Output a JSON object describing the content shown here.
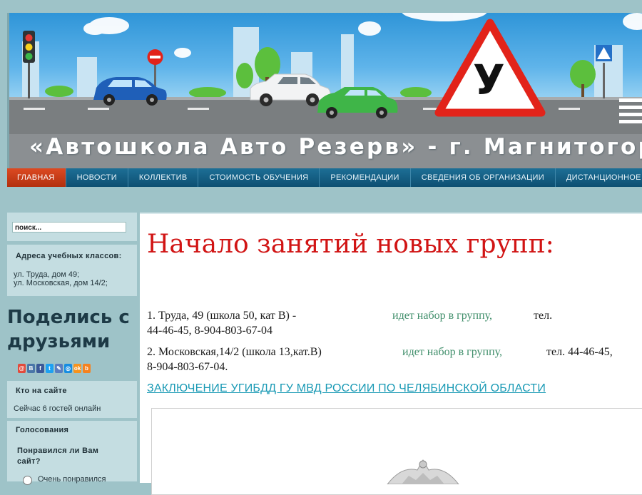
{
  "banner": {
    "title": "«Автошкола Авто Резерв» - г. Магнитогорск",
    "sign_letter": "У"
  },
  "nav": {
    "items": [
      {
        "label": "ГЛАВНАЯ",
        "active": true
      },
      {
        "label": "НОВОСТИ"
      },
      {
        "label": "КОЛЛЕКТИВ"
      },
      {
        "label": "СТОИМОСТЬ ОБУЧЕНИЯ"
      },
      {
        "label": "РЕКОМЕНДАЦИИ"
      },
      {
        "label": "СВЕДЕНИЯ ОБ ОРГАНИЗАЦИИ"
      },
      {
        "label": "ДИСТАНЦИОННОЕ ОБУЧЕНИЕ"
      }
    ]
  },
  "sidebar": {
    "search_placeholder": "поиск...",
    "addresses_heading": "Адреса учебных классов:",
    "address_1": "ул. Труда, дом 49;",
    "address_2": "ул. Московская, дом 14/2;",
    "share_title_1": "Поделись с",
    "share_title_2": "друзьями",
    "who_heading": "Кто на сайте",
    "who_text": "Сейчас 6 гостей онлайн",
    "poll_heading": "Голосования",
    "poll_question_1": "Понравился ли Вам",
    "poll_question_2": "сайт?",
    "poll_option_1": "Очень понравился"
  },
  "main": {
    "title": "Начало занятий новых групп:",
    "line1_a": "1. Труда, 49 (школа 50, кат В) -",
    "line1_b": "идет набор в группу,",
    "line1_c": "тел.",
    "line1_d": "44-46-45, 8-904-803-67-04",
    "line2_a": "2. Московская,14/2 (школа 13,кат.В)",
    "line2_b": "идет набор в группу,",
    "line2_c": "тел. 44-46-45,",
    "line2_d": "8-904-803-67-04.",
    "link": "ЗАКЛЮЧЕНИЕ УГИБДД ГУ МВД РОССИИ ПО ЧЕЛЯБИНСКОЙ ОБЛАСТИ"
  },
  "colors": {
    "accent_red": "#d11414",
    "nav_blue": "#0d4f72",
    "nav_active": "#c33a16",
    "link_teal": "#1a9ab5",
    "text_green": "#3f8e6a"
  }
}
